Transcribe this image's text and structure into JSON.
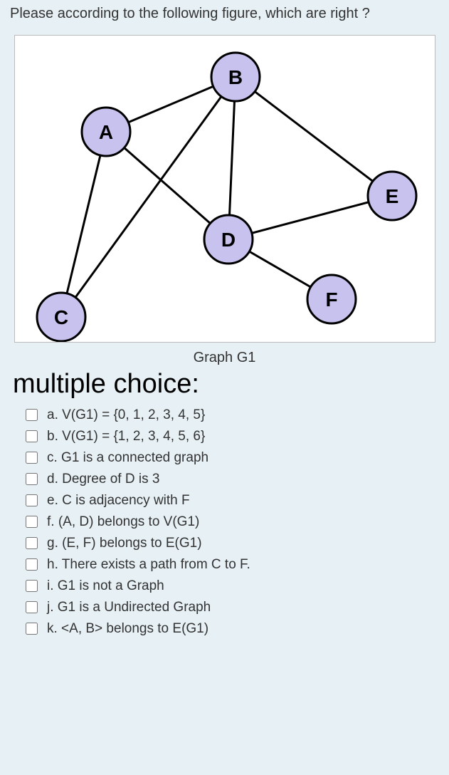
{
  "question": "Please according to the following figure, which are right ?",
  "caption": "Graph G1",
  "mc_title": "multiple choice:",
  "nodes": {
    "A": "A",
    "B": "B",
    "C": "C",
    "D": "D",
    "E": "E",
    "F": "F"
  },
  "options": {
    "a": "a. V(G1) = {0, 1, 2, 3, 4, 5}",
    "b": "b. V(G1) = {1, 2, 3, 4, 5, 6}",
    "c": "c. G1 is a connected graph",
    "d": "d. Degree of D is 3",
    "e": "e. C is adjacency with F",
    "f": "f. (A, D) belongs to V(G1)",
    "g": "g. (E, F) belongs to E(G1)",
    "h": "h. There exists a path from C to F.",
    "i": "i. G1 is not a Graph",
    "j": "j. G1 is a Undirected Graph",
    "k": "k. <A, B> belongs to E(G1)"
  }
}
